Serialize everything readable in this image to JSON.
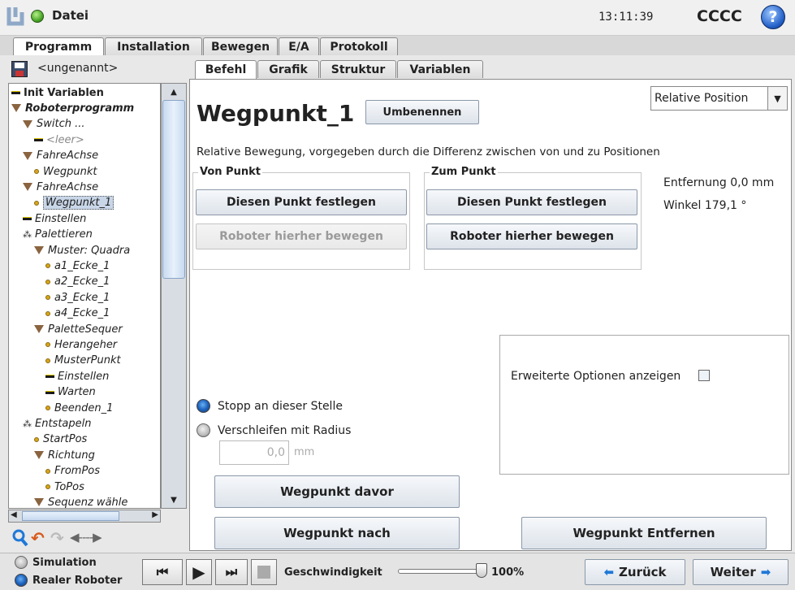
{
  "header": {
    "title": "Datei",
    "time": "13:11:39",
    "robot_name": "CCCC",
    "help_icon": "help-icon"
  },
  "main_tabs": [
    {
      "label": "Programm",
      "active": true
    },
    {
      "label": "Installation",
      "active": false
    },
    {
      "label": "Bewegen",
      "active": false
    },
    {
      "label": "E/A",
      "active": false
    },
    {
      "label": "Protokoll",
      "active": false
    }
  ],
  "program_file": "<ungenannt>",
  "sub_tabs": [
    {
      "label": "Befehl",
      "active": true
    },
    {
      "label": "Grafik",
      "active": false
    },
    {
      "label": "Struktur",
      "active": false
    },
    {
      "label": "Variablen",
      "active": false
    }
  ],
  "tree": [
    {
      "label": "Init Variablen",
      "icon": "dash",
      "level": 0,
      "bold": true
    },
    {
      "label": "Roboterprogramm",
      "icon": "tri",
      "level": 0,
      "bold": true,
      "italic": true
    },
    {
      "label": "Switch ...",
      "icon": "tri",
      "level": 1
    },
    {
      "label": "<leer>",
      "icon": "dash",
      "level": 2,
      "gray": true
    },
    {
      "label": "FahreAchse",
      "icon": "tri",
      "level": 1
    },
    {
      "label": "Wegpunkt",
      "icon": "bullet",
      "level": 2
    },
    {
      "label": "FahreAchse",
      "icon": "tri",
      "level": 1
    },
    {
      "label": "Wegpunkt_1",
      "icon": "bullet",
      "level": 2,
      "selected": true
    },
    {
      "label": "Einstellen",
      "icon": "dash",
      "level": 1
    },
    {
      "label": "Palettieren",
      "icon": "dots",
      "level": 1
    },
    {
      "label": "Muster: Quadra",
      "icon": "tri",
      "level": 2
    },
    {
      "label": "a1_Ecke_1",
      "icon": "bullet",
      "level": 3
    },
    {
      "label": "a2_Ecke_1",
      "icon": "bullet",
      "level": 3
    },
    {
      "label": "a3_Ecke_1",
      "icon": "bullet",
      "level": 3
    },
    {
      "label": "a4_Ecke_1",
      "icon": "bullet",
      "level": 3
    },
    {
      "label": "PaletteSequer",
      "icon": "tri",
      "level": 2
    },
    {
      "label": "Herangeher",
      "icon": "bullet",
      "level": 3
    },
    {
      "label": "MusterPunkt",
      "icon": "bullet",
      "level": 3
    },
    {
      "label": "Einstellen",
      "icon": "dash",
      "level": 3
    },
    {
      "label": "Warten",
      "icon": "dash",
      "level": 3
    },
    {
      "label": "Beenden_1",
      "icon": "bullet",
      "level": 3
    },
    {
      "label": "Entstapeln",
      "icon": "dots",
      "level": 1
    },
    {
      "label": "StartPos",
      "icon": "bullet",
      "level": 2
    },
    {
      "label": "Richtung",
      "icon": "tri",
      "level": 2
    },
    {
      "label": "FromPos",
      "icon": "bullet",
      "level": 3
    },
    {
      "label": "ToPos",
      "icon": "bullet",
      "level": 3
    },
    {
      "label": "Sequenz wähle",
      "icon": "tri",
      "level": 2
    }
  ],
  "content": {
    "title": "Wegpunkt_1",
    "rename_button": "Umbenennen",
    "position_type": "Relative Position",
    "description": "Relative Bewegung, vorgegeben durch die Differenz zwischen von und zu Positionen",
    "from_group": {
      "title": "Von Punkt",
      "set_button": "Diesen Punkt festlegen",
      "move_button": "Roboter hierher bewegen"
    },
    "to_group": {
      "title": "Zum Punkt",
      "set_button": "Diesen Punkt festlegen",
      "move_button": "Roboter hierher bewegen"
    },
    "distance": "Entfernung 0,0 mm",
    "angle": "Winkel 179,1 °",
    "advanced_options": "Erweiterte Optionen anzeigen",
    "stop_radio": "Stopp an dieser Stelle",
    "blend_radio": "Verschleifen mit Radius",
    "radius_value": "0,0",
    "radius_unit": "mm",
    "add_before": "Wegpunkt davor",
    "add_after": "Wegpunkt nach",
    "remove": "Wegpunkt Entfernen"
  },
  "footer": {
    "simulation": "Simulation",
    "real_robot": "Realer Roboter",
    "speed_label": "Geschwindigkeit",
    "speed_value": "100%",
    "speed_fraction": 1.0,
    "back": "Zurück",
    "next": "Weiter"
  }
}
